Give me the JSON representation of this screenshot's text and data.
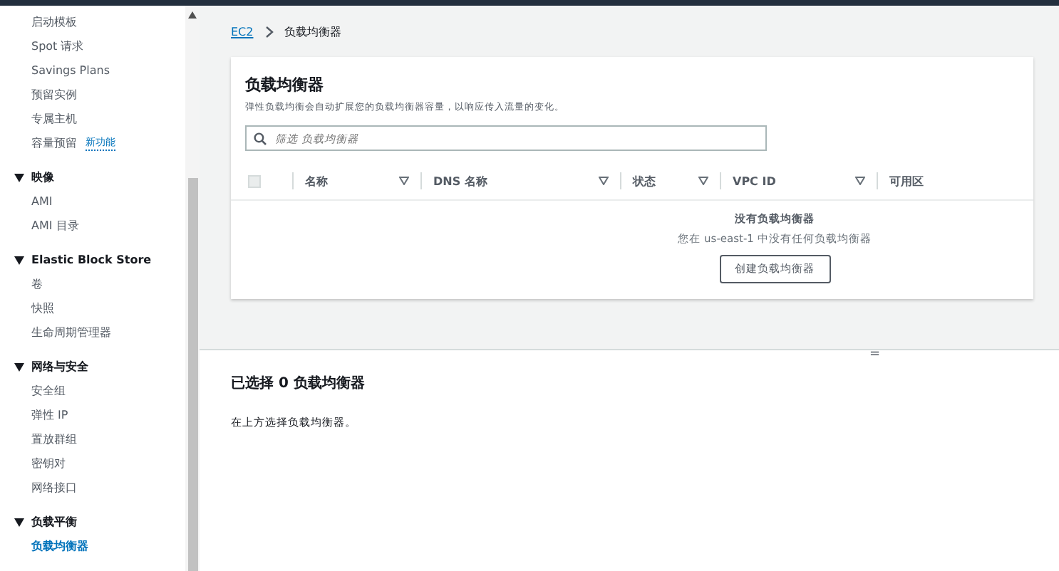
{
  "sidebar": {
    "groups": [
      {
        "items": [
          {
            "label": "启动模板",
            "selected": false
          },
          {
            "label": "Spot 请求",
            "selected": false
          },
          {
            "label": "Savings Plans",
            "selected": false
          },
          {
            "label": "预留实例",
            "selected": false
          },
          {
            "label": "专属主机",
            "selected": false
          },
          {
            "label": "容量预留",
            "badge": "新功能",
            "selected": false
          }
        ]
      },
      {
        "title": "映像",
        "expanded": true,
        "items": [
          {
            "label": "AMI",
            "selected": false
          },
          {
            "label": "AMI 目录",
            "selected": false
          }
        ]
      },
      {
        "title": "Elastic Block Store",
        "expanded": true,
        "items": [
          {
            "label": "卷",
            "selected": false
          },
          {
            "label": "快照",
            "selected": false
          },
          {
            "label": "生命周期管理器",
            "selected": false
          }
        ]
      },
      {
        "title": "网络与安全",
        "expanded": true,
        "items": [
          {
            "label": "安全组",
            "selected": false
          },
          {
            "label": "弹性 IP",
            "selected": false
          },
          {
            "label": "置放群组",
            "selected": false
          },
          {
            "label": "密钥对",
            "selected": false
          },
          {
            "label": "网络接口",
            "selected": false
          }
        ]
      },
      {
        "title": "负载平衡",
        "expanded": true,
        "items": [
          {
            "label": "负载均衡器",
            "selected": true
          }
        ]
      }
    ]
  },
  "breadcrumb": [
    "EC2",
    "负载均衡器"
  ],
  "panel": {
    "title": "负载均衡器",
    "description": "弹性负载均衡会自动扩展您的负载均衡器容量，以响应传入流量的变化。",
    "search": {
      "placeholder": "筛选 负载均衡器"
    },
    "table": {
      "select_all": {
        "checked": false
      },
      "columns": [
        {
          "label": "名称",
          "sortable": true
        },
        {
          "label": "DNS 名称",
          "sortable": true
        },
        {
          "label": "状态",
          "sortable": true
        },
        {
          "label": "VPC ID",
          "sortable": true
        },
        {
          "label": "可用区",
          "sortable": false
        }
      ],
      "empty": {
        "title": "没有负载均衡器",
        "message": "您在 us-east-1 中没有任何负载均衡器",
        "button": "创建负载均衡器"
      }
    }
  },
  "splitter": "=",
  "details": {
    "title": "已选择 0 负载均衡器",
    "message": "在上方选择负载均衡器。"
  }
}
